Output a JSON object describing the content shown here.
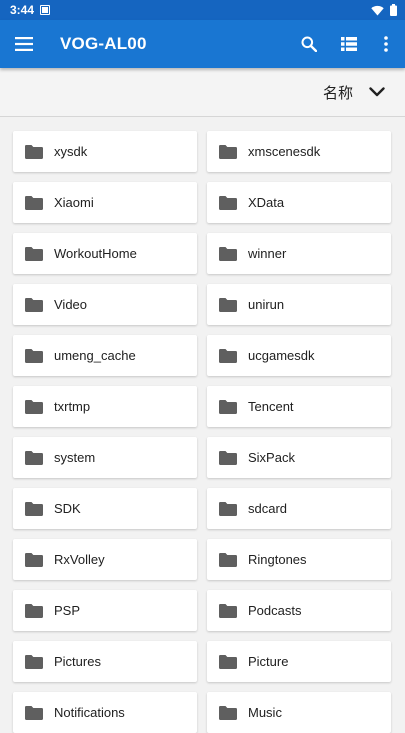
{
  "status_bar": {
    "time": "3:44"
  },
  "app_bar": {
    "title": "VOG-AL00"
  },
  "sort_bar": {
    "label": "名称"
  },
  "folders": [
    "xysdk",
    "xmscenesdk",
    "Xiaomi",
    "XData",
    "WorkoutHome",
    "winner",
    "Video",
    "unirun",
    "umeng_cache",
    "ucgamesdk",
    "txrtmp",
    "Tencent",
    "system",
    "SixPack",
    "SDK",
    "sdcard",
    "RxVolley",
    "Ringtones",
    "PSP",
    "Podcasts",
    "Pictures",
    "Picture",
    "Notifications",
    "Music"
  ],
  "colors": {
    "status_bar": "#1565c0",
    "app_bar": "#1976d2",
    "folder_icon": "#5f5f5f"
  }
}
